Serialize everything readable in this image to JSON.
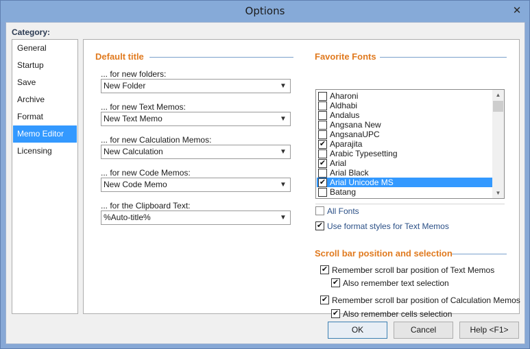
{
  "window": {
    "title": "Options",
    "close_glyph": "✕"
  },
  "category": {
    "label": "Category:",
    "items": [
      {
        "label": "General",
        "selected": false
      },
      {
        "label": "Startup",
        "selected": false
      },
      {
        "label": "Save",
        "selected": false
      },
      {
        "label": "Archive",
        "selected": false
      },
      {
        "label": "Format",
        "selected": false
      },
      {
        "label": "Memo Editor",
        "selected": true
      },
      {
        "label": "Licensing",
        "selected": false
      }
    ]
  },
  "default_title": {
    "heading": "Default title",
    "fields": [
      {
        "label": "... for new folders:",
        "value": "New Folder"
      },
      {
        "label": "... for new Text Memos:",
        "value": "New Text Memo"
      },
      {
        "label": "... for new Calculation Memos:",
        "value": "New Calculation"
      },
      {
        "label": "... for new Code Memos:",
        "value": "New Code Memo"
      },
      {
        "label": "... for the Clipboard Text:",
        "value": "%Auto-title%"
      }
    ]
  },
  "favorite_fonts": {
    "heading": "Favorite Fonts",
    "fonts": [
      {
        "name": "Aharoni",
        "checked": false,
        "selected": false
      },
      {
        "name": "Aldhabi",
        "checked": false,
        "selected": false
      },
      {
        "name": "Andalus",
        "checked": false,
        "selected": false
      },
      {
        "name": "Angsana New",
        "checked": false,
        "selected": false
      },
      {
        "name": "AngsanaUPC",
        "checked": false,
        "selected": false
      },
      {
        "name": "Aparajita",
        "checked": true,
        "selected": false
      },
      {
        "name": "Arabic Typesetting",
        "checked": false,
        "selected": false
      },
      {
        "name": "Arial",
        "checked": true,
        "selected": false
      },
      {
        "name": "Arial Black",
        "checked": false,
        "selected": false
      },
      {
        "name": "Arial Unicode MS",
        "checked": true,
        "selected": true
      },
      {
        "name": "Batang",
        "checked": false,
        "selected": false
      }
    ],
    "all_fonts": {
      "label": "All Fonts",
      "checked": false
    },
    "use_format_styles": {
      "label": "Use format styles for Text Memos",
      "checked": true
    }
  },
  "scroll_bar": {
    "heading": "Scroll bar position and selection",
    "remember_text": {
      "label": "Remember scroll bar position of Text Memos",
      "checked": true
    },
    "remember_text_selection": {
      "label": "Also remember text selection",
      "checked": true
    },
    "remember_calc": {
      "label": "Remember scroll bar position of Calculation Memos",
      "checked": true
    },
    "remember_calc_selection": {
      "label": "Also remember cells selection",
      "checked": true
    }
  },
  "buttons": {
    "ok": "OK",
    "cancel": "Cancel",
    "help": "Help <F1>"
  },
  "icons": {
    "check": "✔",
    "dropdown": "▼",
    "scroll_up": "▲",
    "scroll_down": "▼"
  },
  "colors": {
    "accent_heading": "#e07a1f",
    "selection": "#3399ff",
    "titlebar": "#86aad8"
  }
}
